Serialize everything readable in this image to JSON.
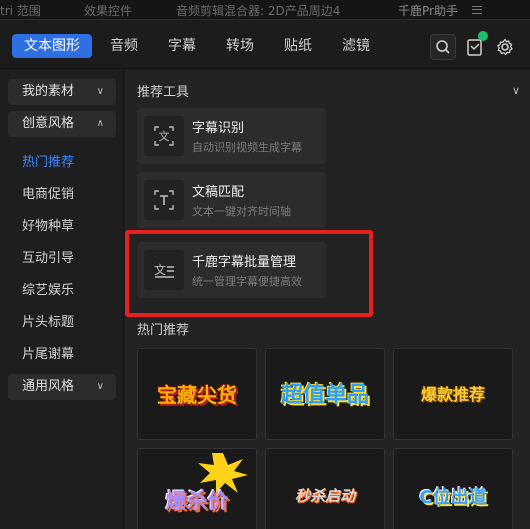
{
  "top_strip": {
    "tabs": [
      "tri 范围",
      "效果控件",
      "音频剪辑混合器: 2D产品周边4",
      "千鹿Pr助手"
    ]
  },
  "nav": {
    "tabs": [
      "文本图形",
      "音频",
      "字幕",
      "转场",
      "贴纸",
      "滤镜"
    ],
    "active_tab": "文本图形",
    "icons": [
      "search-icon",
      "clipboard-check-icon",
      "gear-icon"
    ]
  },
  "sidebar": {
    "groups": [
      {
        "label": "我的素材",
        "chevron": "∨"
      },
      {
        "label": "创意风格",
        "chevron": "∧"
      },
      {
        "label": "通用风格",
        "chevron": "∨"
      }
    ],
    "items": [
      "热门推荐",
      "电商促销",
      "好物种草",
      "互动引导",
      "综艺娱乐",
      "片头标题",
      "片尾谢幕"
    ],
    "active_item": "热门推荐"
  },
  "content": {
    "recommended_title": "推荐工具",
    "collapse_chevron": "∨",
    "tools": [
      {
        "title": "字幕识别",
        "desc": "自动识别视频生成字幕",
        "icon": "subtitle-recognition-icon"
      },
      {
        "title": "文稿匹配",
        "desc": "文本一键对齐时间轴",
        "icon": "text-match-icon"
      },
      {
        "title": "千鹿字幕批量管理",
        "desc": "统一管理字幕便捷高效",
        "icon": "subtitle-batch-icon"
      }
    ],
    "hot_title": "热门推荐",
    "thumbnails": [
      {
        "text": "宝藏尖货",
        "color": "#ffb300"
      },
      {
        "text": "超值单品",
        "color": "#2aa0ff"
      },
      {
        "text": "爆款推荐",
        "color": "#ffcc33"
      },
      {
        "text": "爆杀价",
        "color": "#a78cff"
      },
      {
        "text": "秒杀启动",
        "color": "#cfcfcf"
      },
      {
        "text": "C位出道",
        "color": "#3aa0ff"
      }
    ]
  },
  "colors": {
    "accent": "#2f6fe4",
    "active_link": "#3f86ff",
    "highlight": "#e82020",
    "badge": "#1fbf6a"
  }
}
